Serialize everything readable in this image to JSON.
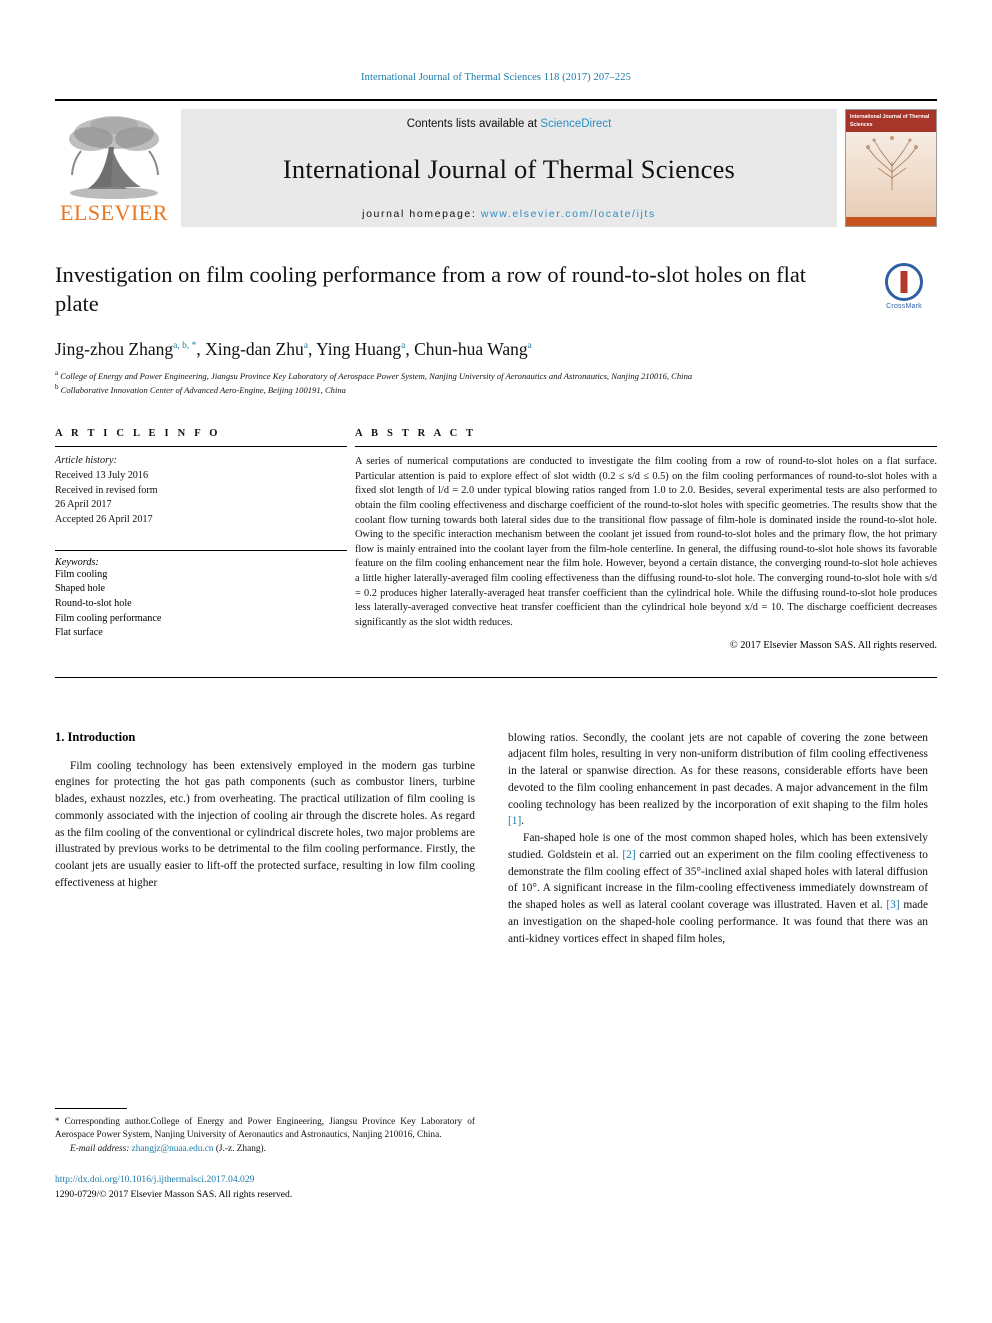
{
  "running_head": "International Journal of Thermal Sciences 118 (2017) 207–225",
  "masthead": {
    "contents_prefix": "Contents lists available at ",
    "contents_link": "ScienceDirect",
    "journal_name": "International Journal of Thermal Sciences",
    "homepage_prefix": "journal homepage: ",
    "homepage_url": "www.elsevier.com/locate/ijts",
    "publisher_name": "ELSEVIER",
    "cover_title_lines": "International Journal of Thermal Sciences",
    "accent_orange": "#E87722",
    "accent_blue": "#2b8fc4"
  },
  "article": {
    "title": "Investigation on film cooling performance from a row of round-to-slot holes on flat plate",
    "crossmark_label": "CrossMark",
    "authors": [
      {
        "name": "Jing-zhou Zhang",
        "marks": "a, b, *"
      },
      {
        "name": "Xing-dan Zhu",
        "marks": "a"
      },
      {
        "name": "Ying Huang",
        "marks": "a"
      },
      {
        "name": "Chun-hua Wang",
        "marks": "a"
      }
    ],
    "affiliations": [
      {
        "mark": "a",
        "text": "College of Energy and Power Engineering, Jiangsu Province Key Laboratory of Aerospace Power System, Nanjing University of Aeronautics and Astronautics, Nanjing 210016, China"
      },
      {
        "mark": "b",
        "text": "Collaborative Innovation Center of Advanced Aero-Engine, Beijing 100191, China"
      }
    ]
  },
  "article_info": {
    "heading": "A R T I C L E  I N F O",
    "history_label": "Article history:",
    "history": [
      "Received 13 July 2016",
      "Received in revised form",
      "26 April 2017",
      "Accepted 26 April 2017"
    ],
    "keywords_label": "Keywords:",
    "keywords": [
      "Film cooling",
      "Shaped hole",
      "Round-to-slot hole",
      "Film cooling performance",
      "Flat surface"
    ]
  },
  "abstract": {
    "heading": "A B S T R A C T",
    "text": "A series of numerical computations are conducted to investigate the film cooling from a row of round-to-slot holes on a flat surface. Particular attention is paid to explore effect of slot width (0.2 ≤ s/d ≤ 0.5) on the film cooling performances of round-to-slot holes with a fixed slot length of l/d = 2.0 under typical blowing ratios ranged from 1.0 to 2.0. Besides, several experimental tests are also performed to obtain the film cooling effectiveness and discharge coefficient of the round-to-slot holes with specific geometries. The results show that the coolant flow turning towards both lateral sides due to the transitional flow passage of film-hole is dominated inside the round-to-slot hole. Owing to the specific interaction mechanism between the coolant jet issued from round-to-slot holes and the primary flow, the hot primary flow is mainly entrained into the coolant layer from the film-hole centerline. In general, the diffusing round-to-slot hole shows its favorable feature on the film cooling enhancement near the film hole. However, beyond a certain distance, the converging round-to-slot hole achieves a little higher laterally-averaged film cooling effectiveness than the diffusing round-to-slot hole. The converging round-to-slot hole with s/d = 0.2 produces higher laterally-averaged heat transfer coefficient than the cylindrical hole. While the diffusing round-to-slot hole produces less laterally-averaged convective heat transfer coefficient than the cylindrical hole beyond x/d = 10. The discharge coefficient decreases significantly as the slot width reduces.",
    "copyright": "© 2017 Elsevier Masson SAS. All rights reserved."
  },
  "body": {
    "section_number_title": "1. Introduction",
    "left_paragraph": "Film cooling technology has been extensively employed in the modern gas turbine engines for protecting the hot gas path components (such as combustor liners, turbine blades, exhaust nozzles, etc.) from overheating. The practical utilization of film cooling is commonly associated with the injection of cooling air through the discrete holes. As regard as the film cooling of the conventional or cylindrical discrete holes, two major problems are illustrated by previous works to be detrimental to the film cooling performance. Firstly, the coolant jets are usually easier to lift-off the protected surface, resulting in low film cooling effectiveness at higher",
    "right_paragraph_1a": "blowing ratios. Secondly, the coolant jets are not capable of covering the zone between adjacent film holes, resulting in very non-uniform distribution of film cooling effectiveness in the lateral or spanwise direction. As for these reasons, considerable efforts have been devoted to the film cooling enhancement in past decades. A major advancement in the film cooling technology has been realized by the incorporation of exit shaping to the film holes ",
    "right_ref_1": "[1]",
    "right_paragraph_1b": ".",
    "right_paragraph_2a": "Fan-shaped hole is one of the most common shaped holes, which has been extensively studied. Goldstein et al. ",
    "right_ref_2": "[2]",
    "right_paragraph_2b": " carried out an experiment on the film cooling effectiveness to demonstrate the film cooling effect of 35°-inclined axial shaped holes with lateral diffusion of 10°. A significant increase in the film-cooling effectiveness immediately downstream of the shaped holes as well as lateral coolant coverage was illustrated. Haven et al. ",
    "right_ref_3": "[3]",
    "right_paragraph_2c": " made an investigation on the shaped-hole cooling performance. It was found that there was an anti-kidney vortices effect in shaped film holes,"
  },
  "footer": {
    "corresponding_star": "*",
    "corresponding_text": " Corresponding author.College of Energy and Power Engineering, Jiangsu Province Key Laboratory of Aerospace Power System, Nanjing University of Aeronautics and Astronautics, Nanjing 210016, China.",
    "email_label": "E-mail address:",
    "email": "zhangjz@nuaa.edu.cn",
    "email_suffix": " (J.-z. Zhang).",
    "doi": "http://dx.doi.org/10.1016/j.ijthermalsci.2017.04.029",
    "issn_line": "1290-0729/© 2017 Elsevier Masson SAS. All rights reserved."
  }
}
